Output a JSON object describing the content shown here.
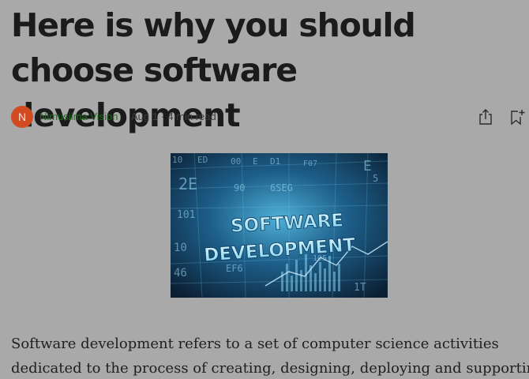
{
  "article": {
    "title": "Here is why you should choose software development",
    "author": {
      "initial": "N",
      "name": "Nimusiima Vision",
      "avatar_color": "#d24a22"
    },
    "date": "Aug 1",
    "separator": "·",
    "read_time": "4 min read",
    "actions": {
      "share_icon": "share-icon",
      "save_icon": "bookmark-add-icon"
    },
    "hero_image": {
      "lines": [
        "SOFTWARE",
        "DEVELOPMENT"
      ],
      "background_codes": [
        "10",
        "ED",
        "00",
        "E",
        "D1",
        "F07",
        "E",
        "90",
        "6SEG",
        "2E",
        "101",
        "46",
        "10",
        "EF6",
        "105",
        "1T",
        "5"
      ]
    },
    "body_lines": [
      "Software development refers to a set of computer science activities",
      "dedicated to the process of creating, designing, deploying and supporting"
    ]
  },
  "colors": {
    "background": "#a9a9a9",
    "title": "#1b1b1b",
    "author_link": "#1d6a1d"
  }
}
